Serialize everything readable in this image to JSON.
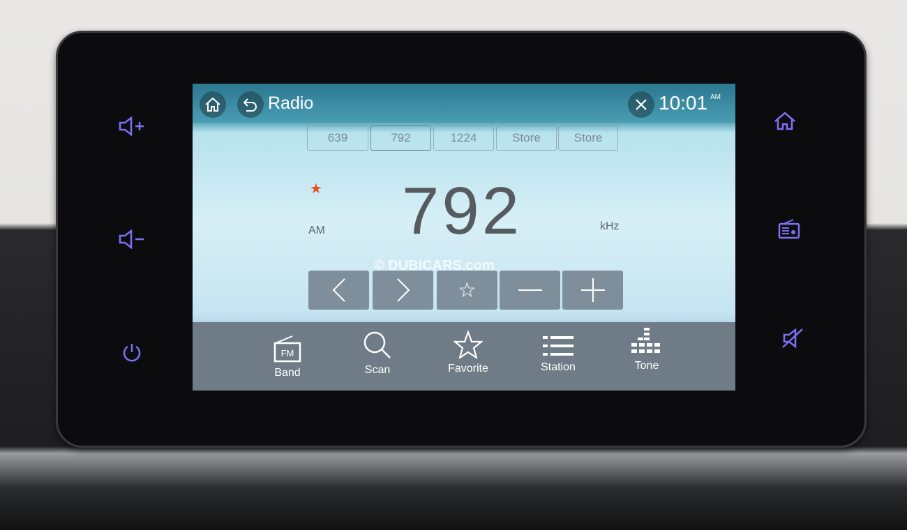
{
  "header": {
    "title": "Radio",
    "time": "10:01",
    "ampm": "AM"
  },
  "presets": [
    "639",
    "792",
    "1224",
    "Store",
    "Store"
  ],
  "tuner": {
    "frequency": "792",
    "band": "AM",
    "unit": "kHz",
    "favorite": true
  },
  "watermark": "© DUBICARS.com",
  "controls": [
    {
      "icon": "chevron-left-icon"
    },
    {
      "icon": "chevron-right-icon"
    },
    {
      "icon": "star-icon"
    },
    {
      "icon": "minus-icon"
    },
    {
      "icon": "plus-icon"
    }
  ],
  "bottom_tabs": [
    {
      "label": "Band",
      "icon": "fm-radio-icon"
    },
    {
      "label": "Scan",
      "icon": "search-icon"
    },
    {
      "label": "Favorite",
      "icon": "star-icon"
    },
    {
      "label": "Station",
      "icon": "list-icon"
    },
    {
      "label": "Tone",
      "icon": "equalizer-icon"
    }
  ],
  "hard_buttons": {
    "left": [
      "volume-up-icon",
      "volume-down-icon",
      "power-icon"
    ],
    "right": [
      "home-icon",
      "radio-icon",
      "mute-icon"
    ]
  },
  "colors": {
    "hard_button": "#7d70f5",
    "favorite_star": "#e8501e"
  }
}
